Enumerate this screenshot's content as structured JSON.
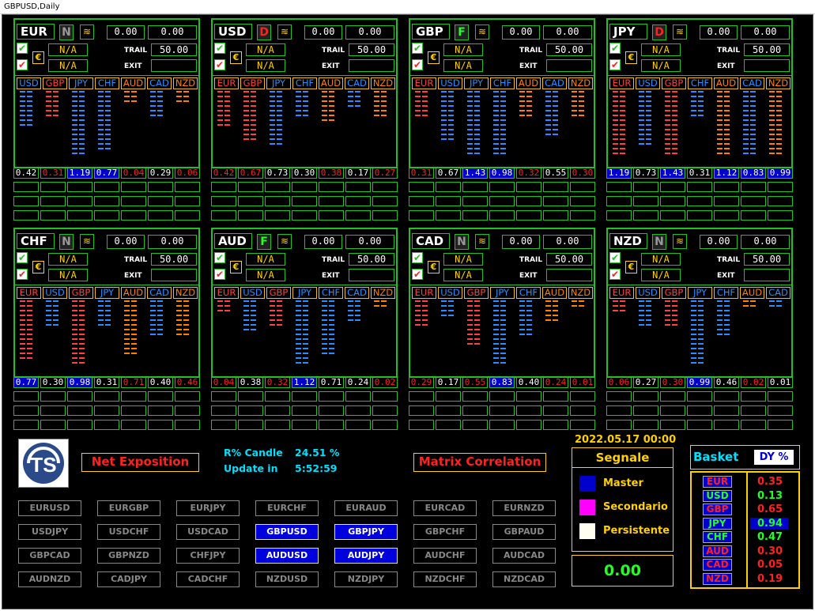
{
  "window": {
    "title": "GBPUSD,Daily"
  },
  "panels": [
    {
      "currency": "EUR",
      "signal": "N",
      "v1": "0.00",
      "v2": "0.00",
      "na1": "N/A",
      "na2": "N/A",
      "trail_label": "TRAIL",
      "trail": "50.00",
      "exit_label": "EXIT",
      "exit": "",
      "cols": [
        "USD",
        "GBP",
        "JPY",
        "CHF",
        "AUD",
        "CAD",
        "NZD"
      ],
      "vals": [
        "0.42",
        "0.31",
        "1.19",
        "0.77",
        "0.04",
        "0.29",
        "0.06"
      ]
    },
    {
      "currency": "USD",
      "signal": "D",
      "v1": "0.00",
      "v2": "0.00",
      "na1": "N/A",
      "na2": "N/A",
      "trail_label": "TRAIL",
      "trail": "50.00",
      "exit_label": "EXIT",
      "exit": "",
      "cols": [
        "EUR",
        "GBP",
        "JPY",
        "CHF",
        "AUD",
        "CAD",
        "NZD"
      ],
      "vals": [
        "0.42",
        "0.67",
        "0.73",
        "0.30",
        "0.38",
        "0.17",
        "0.27"
      ]
    },
    {
      "currency": "GBP",
      "signal": "F",
      "v1": "0.00",
      "v2": "0.00",
      "na1": "N/A",
      "na2": "N/A",
      "trail_label": "TRAIL",
      "trail": "50.00",
      "exit_label": "EXIT",
      "exit": "",
      "cols": [
        "EUR",
        "USD",
        "JPY",
        "CHF",
        "AUD",
        "CAD",
        "NZD"
      ],
      "vals": [
        "0.31",
        "0.67",
        "1.43",
        "0.98",
        "0.32",
        "0.55",
        "0.30"
      ]
    },
    {
      "currency": "JPY",
      "signal": "D",
      "v1": "0.00",
      "v2": "0.00",
      "na1": "N/A",
      "na2": "N/A",
      "trail_label": "TRAIL",
      "trail": "50.00",
      "exit_label": "EXIT",
      "exit": "",
      "cols": [
        "EUR",
        "USD",
        "GBP",
        "CHF",
        "AUD",
        "CAD",
        "NZD"
      ],
      "vals": [
        "1.19",
        "0.73",
        "1.43",
        "0.31",
        "1.12",
        "0.83",
        "0.99"
      ]
    },
    {
      "currency": "CHF",
      "signal": "N",
      "v1": "0.00",
      "v2": "0.00",
      "na1": "N/A",
      "na2": "N/A",
      "trail_label": "TRAIL",
      "trail": "50.00",
      "exit_label": "EXIT",
      "exit": "",
      "cols": [
        "EUR",
        "USD",
        "GBP",
        "JPY",
        "AUD",
        "CAD",
        "NZD"
      ],
      "vals": [
        "0.77",
        "0.30",
        "0.98",
        "0.31",
        "0.71",
        "0.40",
        "0.46"
      ]
    },
    {
      "currency": "AUD",
      "signal": "F",
      "v1": "0.00",
      "v2": "0.00",
      "na1": "N/A",
      "na2": "N/A",
      "trail_label": "TRAIL",
      "trail": "50.00",
      "exit_label": "EXIT",
      "exit": "",
      "cols": [
        "EUR",
        "USD",
        "GBP",
        "JPY",
        "CHF",
        "CAD",
        "NZD"
      ],
      "vals": [
        "0.04",
        "0.38",
        "0.32",
        "1.12",
        "0.71",
        "0.24",
        "0.02"
      ]
    },
    {
      "currency": "CAD",
      "signal": "N",
      "v1": "0.00",
      "v2": "0.00",
      "na1": "N/A",
      "na2": "N/A",
      "trail_label": "TRAIL",
      "trail": "50.00",
      "exit_label": "EXIT",
      "exit": "",
      "cols": [
        "EUR",
        "USD",
        "GBP",
        "JPY",
        "CHF",
        "AUD",
        "NZD"
      ],
      "vals": [
        "0.29",
        "0.17",
        "0.55",
        "0.83",
        "0.40",
        "0.24",
        "0.01"
      ]
    },
    {
      "currency": "NZD",
      "signal": "N",
      "v1": "0.00",
      "v2": "0.00",
      "na1": "N/A",
      "na2": "N/A",
      "trail_label": "TRAIL",
      "trail": "50.00",
      "exit_label": "EXIT",
      "exit": "",
      "cols": [
        "EUR",
        "USD",
        "GBP",
        "JPY",
        "CHF",
        "AUD",
        "CAD"
      ],
      "vals": [
        "0.06",
        "0.27",
        "0.30",
        "0.99",
        "0.46",
        "0.02",
        "0.01"
      ]
    }
  ],
  "colors": {
    "green": "#22c022",
    "red": "#ff2020",
    "blue": "#2a8cff",
    "orange": "#e06000",
    "yellow": "#ffd000",
    "cyan": "#00e0ff",
    "selected": "#0000dd"
  },
  "buttons": {
    "net_exposition": "Net Exposition",
    "matrix_correlation": "Matrix Correlation"
  },
  "stats": {
    "candle_label": "R% Candle",
    "candle_value": "24.51 %",
    "update_label": "Update in",
    "update_value": "5:52:59"
  },
  "pairs": [
    "EURUSD",
    "EURGBP",
    "EURJPY",
    "EURCHF",
    "EURAUD",
    "EURCAD",
    "EURNZD",
    "USDJPY",
    "USDCHF",
    "USDCAD",
    "GBPUSD",
    "GBPJPY",
    "GBPCHF",
    "GBPAUD",
    "GBPCAD",
    "GBPNZD",
    "CHFJPY",
    "AUDUSD",
    "AUDJPY",
    "AUDCHF",
    "AUDCAD",
    "AUDNZD",
    "CADJPY",
    "CADCHF",
    "NZDUSD",
    "NZDJPY",
    "NZDCHF",
    "NZDCAD"
  ],
  "selected_pairs": [
    "GBPUSD",
    "GBPJPY",
    "AUDUSD",
    "AUDJPY"
  ],
  "datetime": "2022.05.17 00:00",
  "signale": {
    "title": "Segnale",
    "legend": [
      {
        "label": "Master",
        "color": "#0000cc"
      },
      {
        "label": "Secondario",
        "color": "#ff00ff"
      },
      {
        "label": "Persistente",
        "color": "#fffff0"
      }
    ],
    "total": "0.00"
  },
  "basket": {
    "label": "Basket",
    "mode": "DY %",
    "items": [
      {
        "cur": "EUR",
        "val": "0.35"
      },
      {
        "cur": "USD",
        "val": "0.13"
      },
      {
        "cur": "GBP",
        "val": "0.65"
      },
      {
        "cur": "JPY",
        "val": "0.94"
      },
      {
        "cur": "CHF",
        "val": "0.47"
      },
      {
        "cur": "AUD",
        "val": "0.30"
      },
      {
        "cur": "CAD",
        "val": "0.05"
      },
      {
        "cur": "NZD",
        "val": "0.19"
      }
    ]
  }
}
